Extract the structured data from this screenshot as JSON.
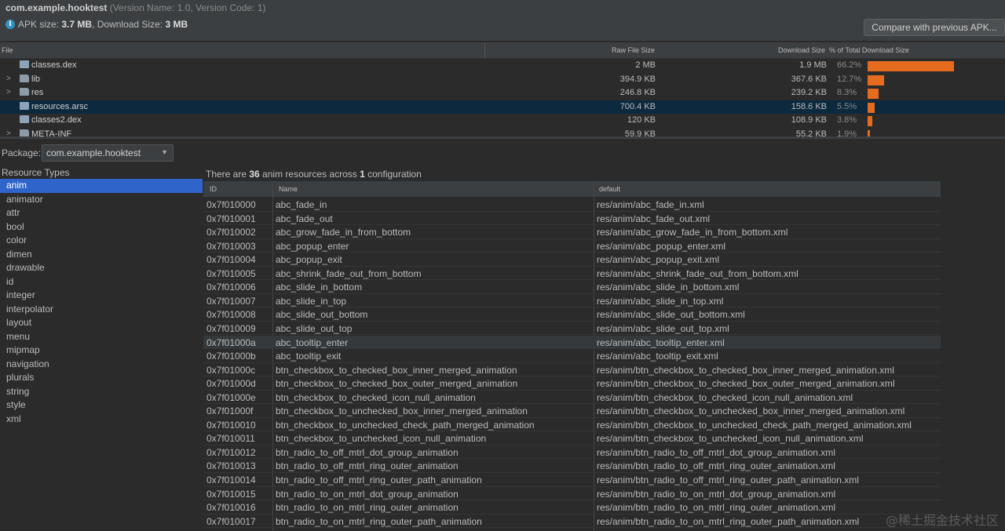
{
  "header": {
    "package": "com.example.hooktest",
    "version": "(Version Name: 1.0, Version Code: 1)",
    "apk_size_label": "APK size:",
    "apk_size": "3.7 MB",
    "download_size_label": ", Download Size:",
    "download_size": "3 MB",
    "compare_button": "Compare with previous APK..."
  },
  "file_table": {
    "columns": [
      "File",
      "Raw File Size",
      "Download Size",
      "% of Total Download Size"
    ],
    "rows": [
      {
        "name": "classes.dex",
        "expandable": false,
        "icon": "dex-file-icon",
        "raw": "2 MB",
        "download": "1.9 MB",
        "pct": "66.2%",
        "fraction": 0.662
      },
      {
        "name": "lib",
        "expandable": true,
        "icon": "folder-icon",
        "raw": "394.9 KB",
        "download": "367.6 KB",
        "pct": "12.7%",
        "fraction": 0.127
      },
      {
        "name": "res",
        "expandable": true,
        "icon": "folder-icon",
        "raw": "246.8 KB",
        "download": "239.2 KB",
        "pct": "8.3%",
        "fraction": 0.083
      },
      {
        "name": "resources.arsc",
        "expandable": false,
        "icon": "arsc-file-icon",
        "raw": "700.4 KB",
        "download": "158.6 KB",
        "pct": "5.5%",
        "fraction": 0.055,
        "selected": true
      },
      {
        "name": "classes2.dex",
        "expandable": false,
        "icon": "dex-file-icon",
        "raw": "120 KB",
        "download": "108.9 KB",
        "pct": "3.8%",
        "fraction": 0.038
      },
      {
        "name": "META-INF",
        "expandable": true,
        "icon": "folder-icon",
        "raw": "59.9 KB",
        "download": "55.2 KB",
        "pct": "1.9%",
        "fraction": 0.019
      }
    ]
  },
  "package_selector": {
    "label": "Package:",
    "value": "com.example.hooktest"
  },
  "resource_types": {
    "title": "Resource Types",
    "items": [
      "anim",
      "animator",
      "attr",
      "bool",
      "color",
      "dimen",
      "drawable",
      "id",
      "integer",
      "interpolator",
      "layout",
      "menu",
      "mipmap",
      "navigation",
      "plurals",
      "string",
      "style",
      "xml"
    ],
    "selected": "anim"
  },
  "resources": {
    "summary_prefix": "There are ",
    "count": "36",
    "summary_mid": " anim resources across ",
    "configs": "1",
    "summary_suffix": " configuration",
    "columns": [
      "ID",
      "Name",
      "default"
    ],
    "rows": [
      [
        "0x7f010000",
        "abc_fade_in",
        "res/anim/abc_fade_in.xml"
      ],
      [
        "0x7f010001",
        "abc_fade_out",
        "res/anim/abc_fade_out.xml"
      ],
      [
        "0x7f010002",
        "abc_grow_fade_in_from_bottom",
        "res/anim/abc_grow_fade_in_from_bottom.xml"
      ],
      [
        "0x7f010003",
        "abc_popup_enter",
        "res/anim/abc_popup_enter.xml"
      ],
      [
        "0x7f010004",
        "abc_popup_exit",
        "res/anim/abc_popup_exit.xml"
      ],
      [
        "0x7f010005",
        "abc_shrink_fade_out_from_bottom",
        "res/anim/abc_shrink_fade_out_from_bottom.xml"
      ],
      [
        "0x7f010006",
        "abc_slide_in_bottom",
        "res/anim/abc_slide_in_bottom.xml"
      ],
      [
        "0x7f010007",
        "abc_slide_in_top",
        "res/anim/abc_slide_in_top.xml"
      ],
      [
        "0x7f010008",
        "abc_slide_out_bottom",
        "res/anim/abc_slide_out_bottom.xml"
      ],
      [
        "0x7f010009",
        "abc_slide_out_top",
        "res/anim/abc_slide_out_top.xml"
      ],
      [
        "0x7f01000a",
        "abc_tooltip_enter",
        "res/anim/abc_tooltip_enter.xml"
      ],
      [
        "0x7f01000b",
        "abc_tooltip_exit",
        "res/anim/abc_tooltip_exit.xml"
      ],
      [
        "0x7f01000c",
        "btn_checkbox_to_checked_box_inner_merged_animation",
        "res/anim/btn_checkbox_to_checked_box_inner_merged_animation.xml"
      ],
      [
        "0x7f01000d",
        "btn_checkbox_to_checked_box_outer_merged_animation",
        "res/anim/btn_checkbox_to_checked_box_outer_merged_animation.xml"
      ],
      [
        "0x7f01000e",
        "btn_checkbox_to_checked_icon_null_animation",
        "res/anim/btn_checkbox_to_checked_icon_null_animation.xml"
      ],
      [
        "0x7f01000f",
        "btn_checkbox_to_unchecked_box_inner_merged_animation",
        "res/anim/btn_checkbox_to_unchecked_box_inner_merged_animation.xml"
      ],
      [
        "0x7f010010",
        "btn_checkbox_to_unchecked_check_path_merged_animation",
        "res/anim/btn_checkbox_to_unchecked_check_path_merged_animation.xml"
      ],
      [
        "0x7f010011",
        "btn_checkbox_to_unchecked_icon_null_animation",
        "res/anim/btn_checkbox_to_unchecked_icon_null_animation.xml"
      ],
      [
        "0x7f010012",
        "btn_radio_to_off_mtrl_dot_group_animation",
        "res/anim/btn_radio_to_off_mtrl_dot_group_animation.xml"
      ],
      [
        "0x7f010013",
        "btn_radio_to_off_mtrl_ring_outer_animation",
        "res/anim/btn_radio_to_off_mtrl_ring_outer_animation.xml"
      ],
      [
        "0x7f010014",
        "btn_radio_to_off_mtrl_ring_outer_path_animation",
        "res/anim/btn_radio_to_off_mtrl_ring_outer_path_animation.xml"
      ],
      [
        "0x7f010015",
        "btn_radio_to_on_mtrl_dot_group_animation",
        "res/anim/btn_radio_to_on_mtrl_dot_group_animation.xml"
      ],
      [
        "0x7f010016",
        "btn_radio_to_on_mtrl_ring_outer_animation",
        "res/anim/btn_radio_to_on_mtrl_ring_outer_animation.xml"
      ],
      [
        "0x7f010017",
        "btn_radio_to_on_mtrl_ring_outer_path_animation",
        "res/anim/btn_radio_to_on_mtrl_ring_outer_path_animation.xml"
      ]
    ],
    "highlighted_row": "0x7f01000a"
  },
  "watermark": "@稀土掘金技术社区",
  "colors": {
    "accent": "#2f65ca",
    "bar": "#e56b1f",
    "selected_row": "#0d293e"
  }
}
